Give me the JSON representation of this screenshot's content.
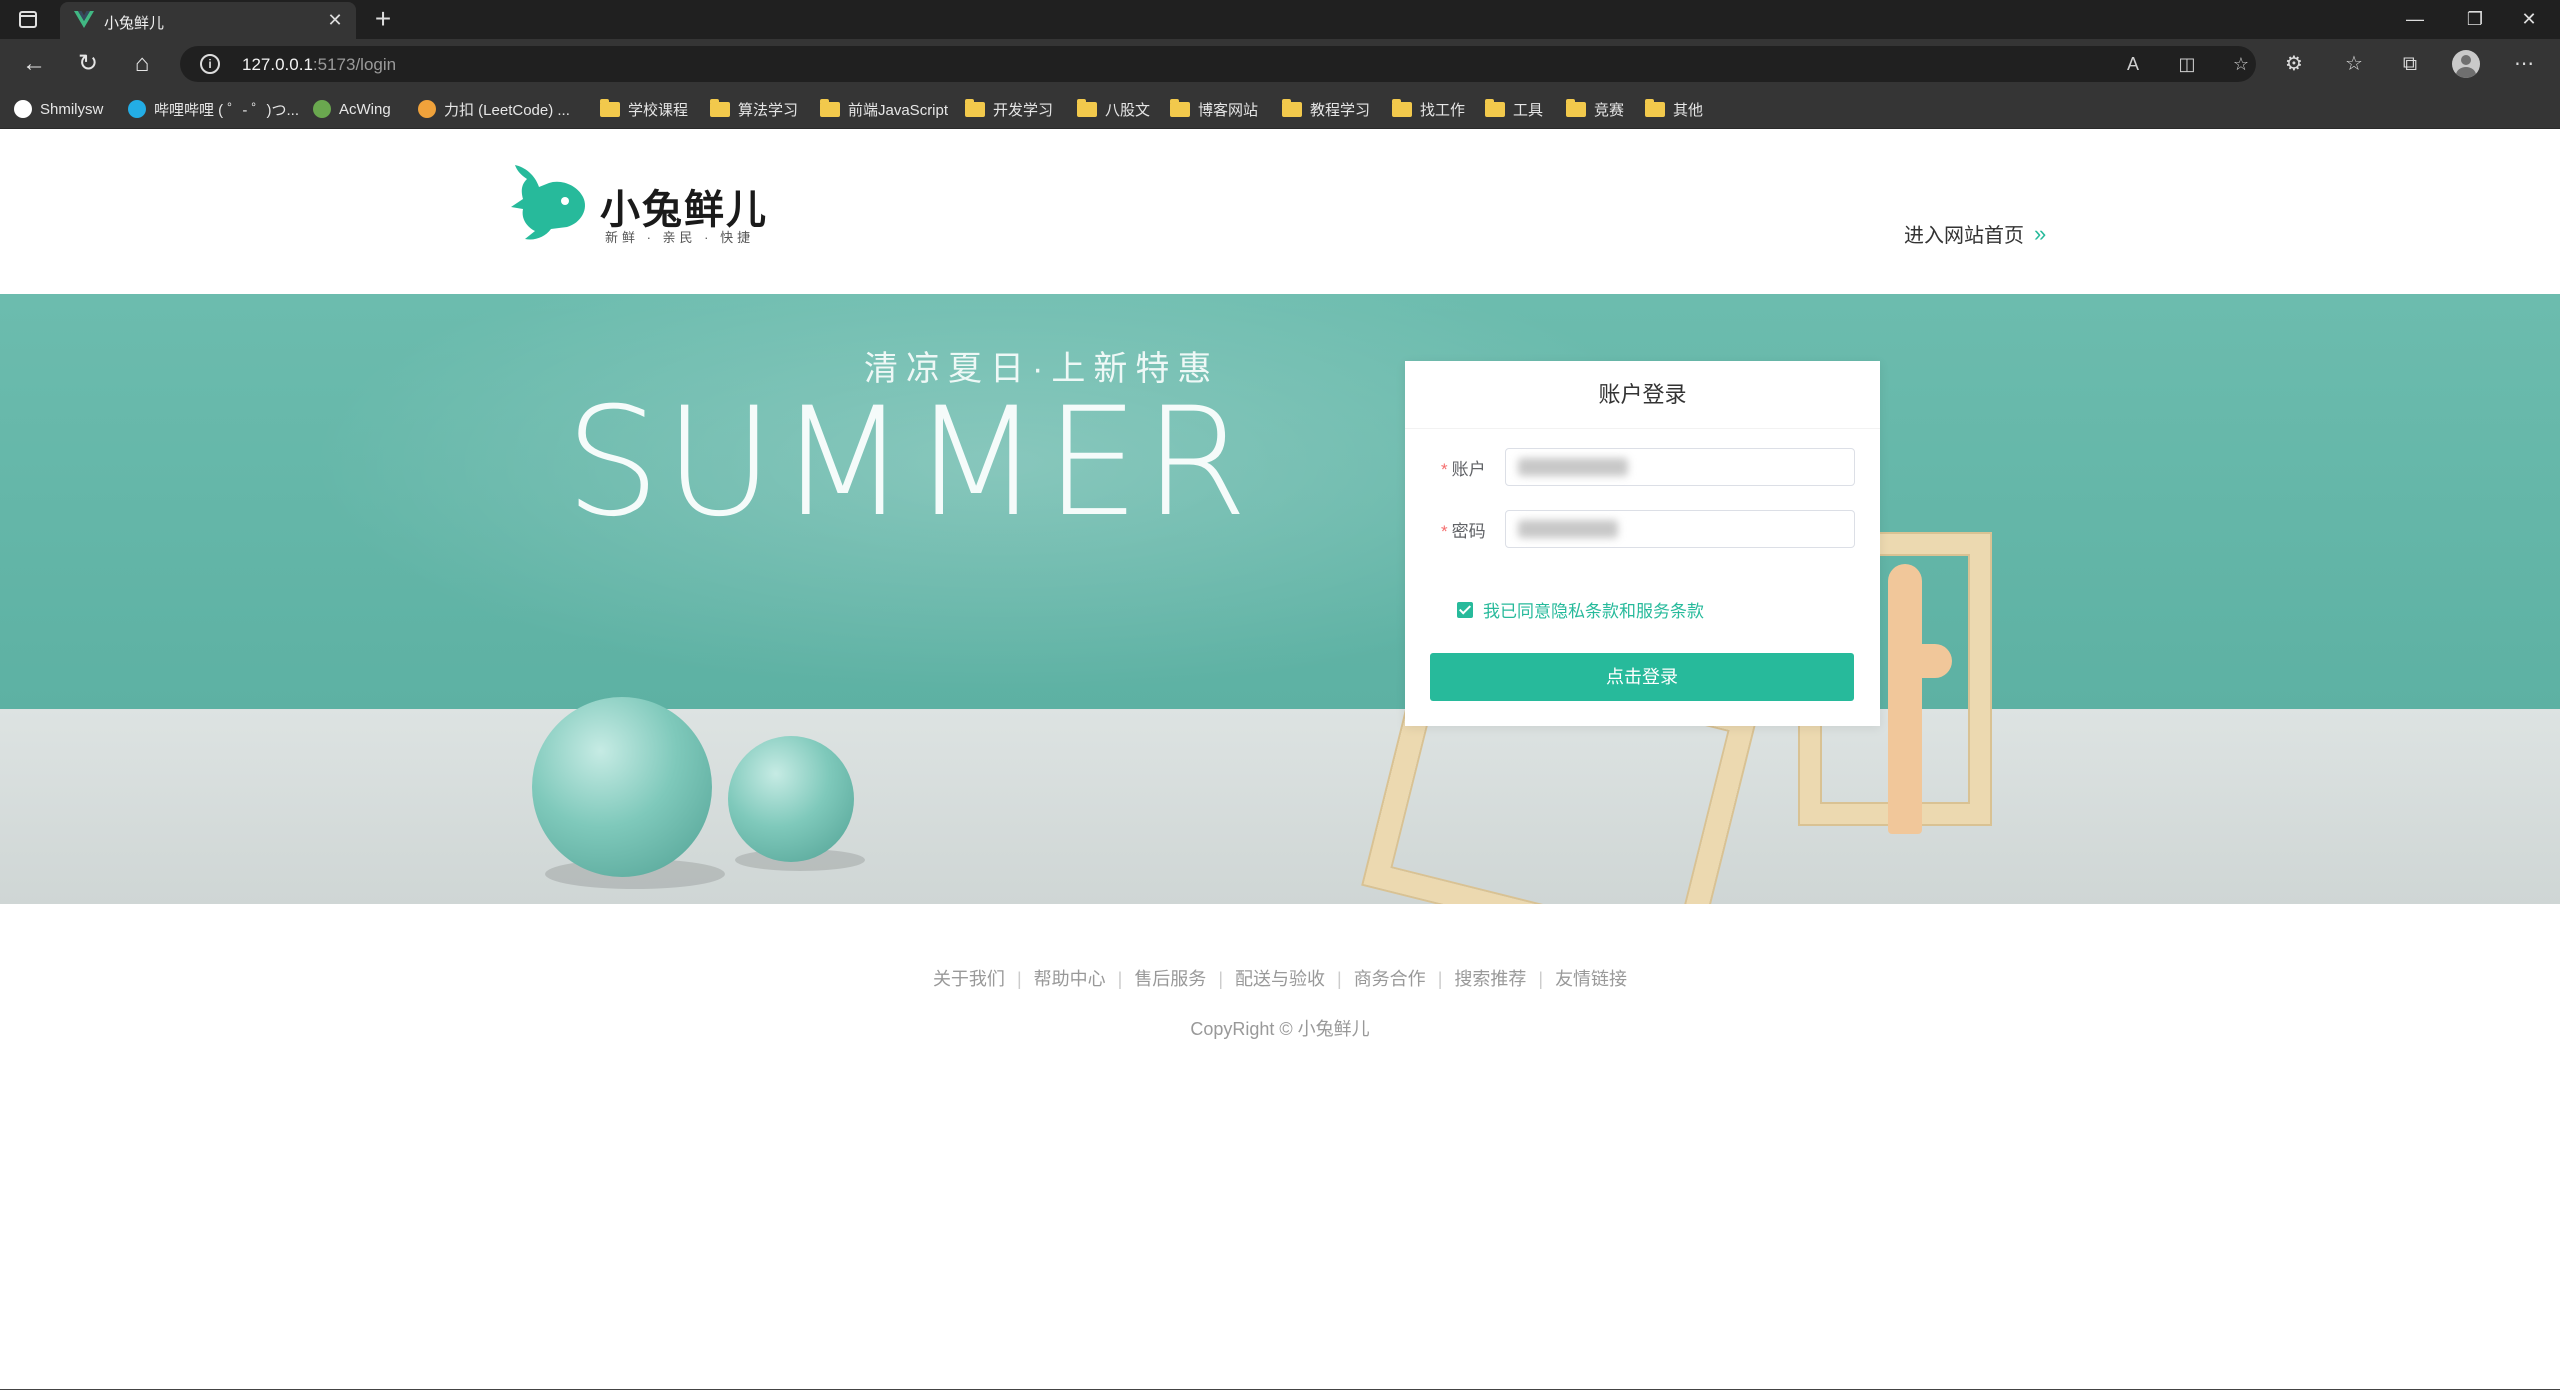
{
  "browser": {
    "tab_title": "小兔鲜儿",
    "url_host": "127.0.0.1",
    "url_rest": ":5173/login",
    "bookmarks": [
      {
        "label": "Shmilysw",
        "icon": "github-icon"
      },
      {
        "label": "哔哩哔哩 ( ゜- ゜)つ...",
        "icon": "bilibili-icon"
      },
      {
        "label": "AcWing",
        "icon": "acwing-icon"
      },
      {
        "label": "力扣 (LeetCode) ...",
        "icon": "leetcode-icon"
      },
      {
        "label": "学校课程",
        "icon": "folder-icon"
      },
      {
        "label": "算法学习",
        "icon": "folder-icon"
      },
      {
        "label": "前端JavaScript",
        "icon": "folder-icon"
      },
      {
        "label": "开发学习",
        "icon": "folder-icon"
      },
      {
        "label": "八股文",
        "icon": "folder-icon"
      },
      {
        "label": "博客网站",
        "icon": "folder-icon"
      },
      {
        "label": "教程学习",
        "icon": "folder-icon"
      },
      {
        "label": "找工作",
        "icon": "folder-icon"
      },
      {
        "label": "工具",
        "icon": "folder-icon"
      },
      {
        "label": "竞赛",
        "icon": "folder-icon"
      },
      {
        "label": "其他",
        "icon": "folder-icon"
      }
    ]
  },
  "header": {
    "logo_name": "小兔鲜儿",
    "logo_slogan": "新鲜 · 亲民 · 快捷",
    "entry_link": "进入网站首页",
    "entry_arrows": "»"
  },
  "banner": {
    "promo_sub": "清凉夏日·上新特惠",
    "promo_big": "SUMMER"
  },
  "login": {
    "title": "账户登录",
    "account_label": "账户",
    "password_label": "密码",
    "required_mark": "*",
    "agree_text": "我已同意隐私条款和服务条款",
    "agree_checked": true,
    "submit_label": "点击登录"
  },
  "footer": {
    "links": [
      "关于我们",
      "帮助中心",
      "售后服务",
      "配送与验收",
      "商务合作",
      "搜索推荐",
      "友情链接"
    ],
    "copyright": "CopyRight © 小兔鲜儿"
  },
  "colors": {
    "brand": "#27ba9b",
    "banner_teal": "#5db1a3",
    "browser_dark": "#202020"
  }
}
